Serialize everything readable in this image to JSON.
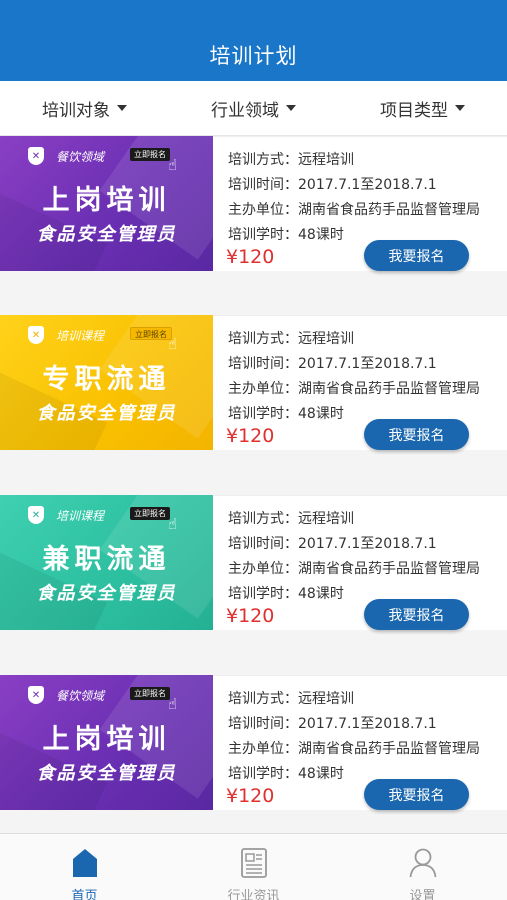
{
  "header": {
    "title": "培训计划"
  },
  "filters": [
    {
      "label": "培训对象"
    },
    {
      "label": "行业领域"
    },
    {
      "label": "项目类型"
    }
  ],
  "courses": [
    {
      "banner": {
        "theme": "purple",
        "category": "餐饮领域",
        "cta": "立即报名",
        "headline": "上岗培训",
        "subtitle": "食品安全管理员"
      },
      "method": "培训方式：远程培训",
      "time": "培训时间：2017.7.1至2018.7.1",
      "organizer": "主办单位：湖南省食品药手品监督管理局",
      "hours": "培训学时：48课时",
      "price": "¥120",
      "button": "我要报名"
    },
    {
      "banner": {
        "theme": "yellow",
        "category": "培训课程",
        "cta": "立即报名",
        "headline": "专职流通",
        "subtitle": "食品安全管理员"
      },
      "method": "培训方式：远程培训",
      "time": "培训时间：2017.7.1至2018.7.1",
      "organizer": "主办单位：湖南省食品药手品监督管理局",
      "hours": "培训学时：48课时",
      "price": "¥120",
      "button": "我要报名"
    },
    {
      "banner": {
        "theme": "teal",
        "category": "培训课程",
        "cta": "立即报名",
        "headline": "兼职流通",
        "subtitle": "食品安全管理员"
      },
      "method": "培训方式：远程培训",
      "time": "培训时间：2017.7.1至2018.7.1",
      "organizer": "主办单位：湖南省食品药手品监督管理局",
      "hours": "培训学时：48课时",
      "price": "¥120",
      "button": "我要报名"
    },
    {
      "banner": {
        "theme": "purple",
        "category": "餐饮领域",
        "cta": "立即报名",
        "headline": "上岗培训",
        "subtitle": "食品安全管理员"
      },
      "method": "培训方式：远程培训",
      "time": "培训时间：2017.7.1至2018.7.1",
      "organizer": "主办单位：湖南省食品药手品监督管理局",
      "hours": "培训学时：48课时",
      "price": "¥120",
      "button": "我要报名"
    }
  ],
  "bottom_nav": [
    {
      "label": "首页",
      "icon": "home-icon",
      "active": true
    },
    {
      "label": "行业资讯",
      "icon": "news-icon",
      "active": false
    },
    {
      "label": "设置",
      "icon": "user-icon",
      "active": false
    }
  ],
  "colors": {
    "primary": "#1976c8",
    "button": "#1a67b0",
    "price": "#e02f2f"
  }
}
